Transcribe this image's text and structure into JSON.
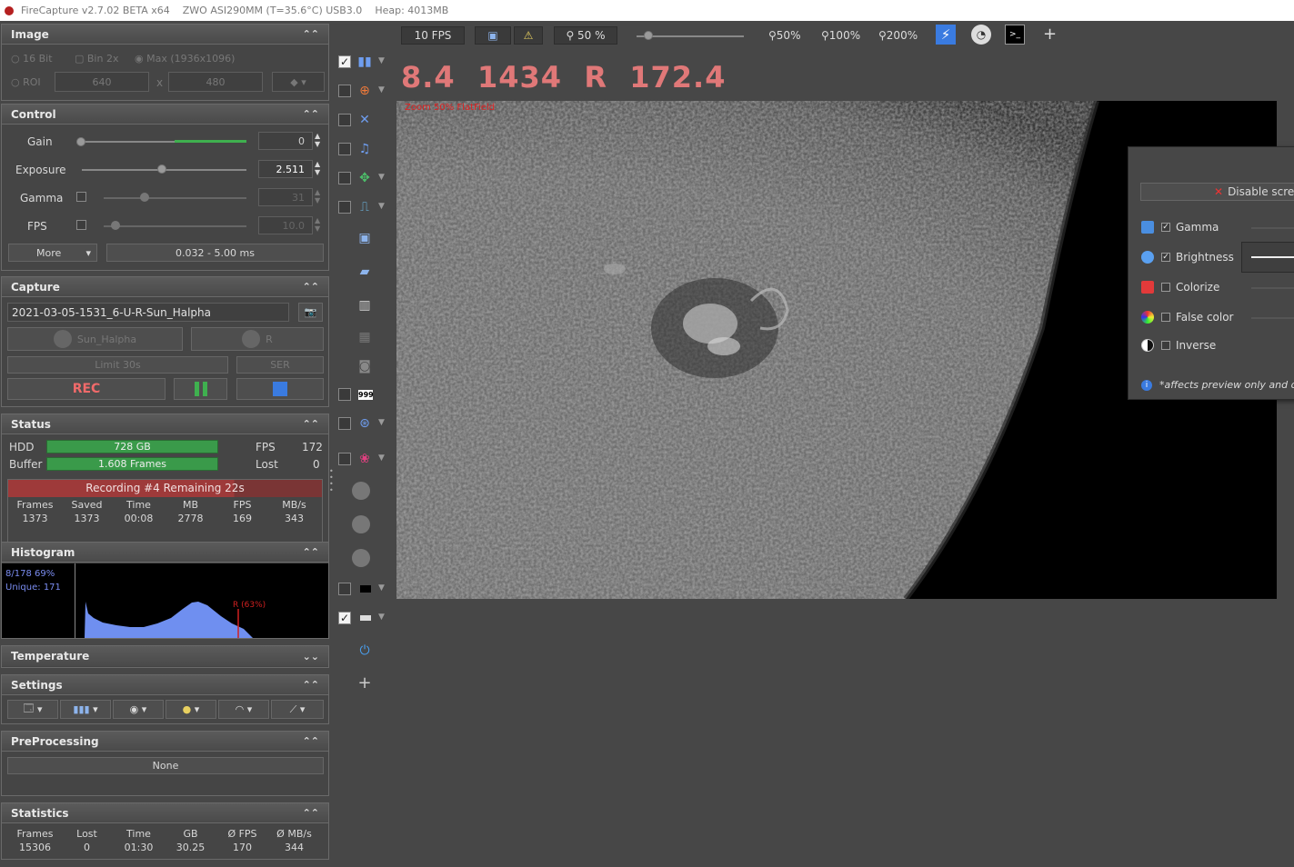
{
  "titlebar": {
    "app": "FireCapture v2.7.02 BETA x64",
    "camera": "ZWO ASI290MM (T=35.6°C) USB3.0",
    "heap": "Heap: 4013MB"
  },
  "image_panel": {
    "title": "Image",
    "bit16": "16 Bit",
    "bin2x": "Bin 2x",
    "max": "Max (1936x1096)",
    "roi": "ROI",
    "width": "640",
    "x": "x",
    "height": "480"
  },
  "control_panel": {
    "title": "Control",
    "gain_label": "Gain",
    "gain_value": "0",
    "exposure_label": "Exposure",
    "exposure_value": "2.511",
    "gamma_label": "Gamma",
    "gamma_value": "31",
    "fps_label": "FPS",
    "fps_value": "10.0",
    "more_label": "More",
    "range": "0.032 - 5.00 ms",
    "gain_level": 0.55,
    "exposure_level": 0.5
  },
  "capture_panel": {
    "title": "Capture",
    "filename": "2021-03-05-1531_6-U-R-Sun_Halpha",
    "profile": "Sun_Halpha",
    "filter": "R",
    "limit": "Limit 30s",
    "format": "SER",
    "rec": "REC"
  },
  "status_panel": {
    "title": "Status",
    "hdd_label": "HDD",
    "hdd_value": "728 GB",
    "buffer_label": "Buffer",
    "buffer_value": "1.608 Frames",
    "fps_label": "FPS",
    "fps_value": "172",
    "lost_label": "Lost",
    "lost_value": "0",
    "recording": "Recording #4  Remaining  22s",
    "headers": [
      "Frames",
      "Saved",
      "Time",
      "MB",
      "FPS",
      "MB/s"
    ],
    "values": [
      "1373",
      "1373",
      "00:08",
      "2778",
      "169",
      "343"
    ]
  },
  "histogram_panel": {
    "title": "Histogram",
    "line1": "8/178 69%",
    "line2": "Unique: 171",
    "marker": "R (63%)"
  },
  "temperature_panel": {
    "title": "Temperature"
  },
  "settings_panel": {
    "title": "Settings"
  },
  "preprocessing_panel": {
    "title": "PreProcessing",
    "value": "None"
  },
  "statistics_panel": {
    "title": "Statistics",
    "headers": [
      "Frames",
      "Lost",
      "Time",
      "GB",
      "Ø FPS",
      "Ø MB/s"
    ],
    "values": [
      "15306",
      "0",
      "01:30",
      "30.25",
      "170",
      "344"
    ]
  },
  "topbar": {
    "fps": "10 FPS",
    "zoom_pct": "50 %",
    "zoom50": "50%",
    "zoom100": "100%",
    "zoom200": "200%"
  },
  "readout": {
    "a": "8.4",
    "b": "1434",
    "c": "R",
    "d": "172.4"
  },
  "preview": {
    "overlay_text": "Zoom 50%   FlatField"
  },
  "display_panel": {
    "disable_label": "Disable scre",
    "gamma": "Gamma",
    "brightness": "Brightness",
    "colorize": "Colorize",
    "false_color": "False color",
    "inverse": "Inverse",
    "note": "*affects preview only and d"
  },
  "colors": {
    "accent_red": "#e07878",
    "green_bar": "#3a9a4a",
    "histogram_blue": "#6f8ff0",
    "recording_red": "#9e3a3a"
  }
}
